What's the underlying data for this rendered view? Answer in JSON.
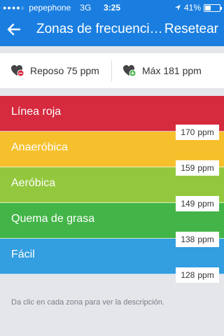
{
  "status_bar": {
    "carrier": "pepephone",
    "network": "3G",
    "time": "3:25",
    "battery": "41%",
    "battery_level": 0.41
  },
  "nav": {
    "title": "Zonas de frecuencia...",
    "reset_label": "Resetear"
  },
  "heart_rates": {
    "rest": "Reposo 75 ppm",
    "max": "Máx 181 ppm"
  },
  "zones": [
    {
      "label": "Línea roja",
      "color": "#d62a3e",
      "bpm": "170",
      "unit": "ppm"
    },
    {
      "label": "Anaeróbica",
      "color": "#f6c02d",
      "bpm": "159",
      "unit": "ppm"
    },
    {
      "label": "Aeróbica",
      "color": "#93c83e",
      "bpm": "149",
      "unit": "ppm"
    },
    {
      "label": "Quema de grasa",
      "color": "#43b548",
      "bpm": "138",
      "unit": "ppm"
    },
    {
      "label": "Fácil",
      "color": "#339ee0",
      "bpm": "128",
      "unit": "ppm"
    }
  ],
  "hint": "Da clic en cada zona para ver la descripción.",
  "colors": {
    "header": "#1a7ee0",
    "background": "#e4e6ea"
  }
}
